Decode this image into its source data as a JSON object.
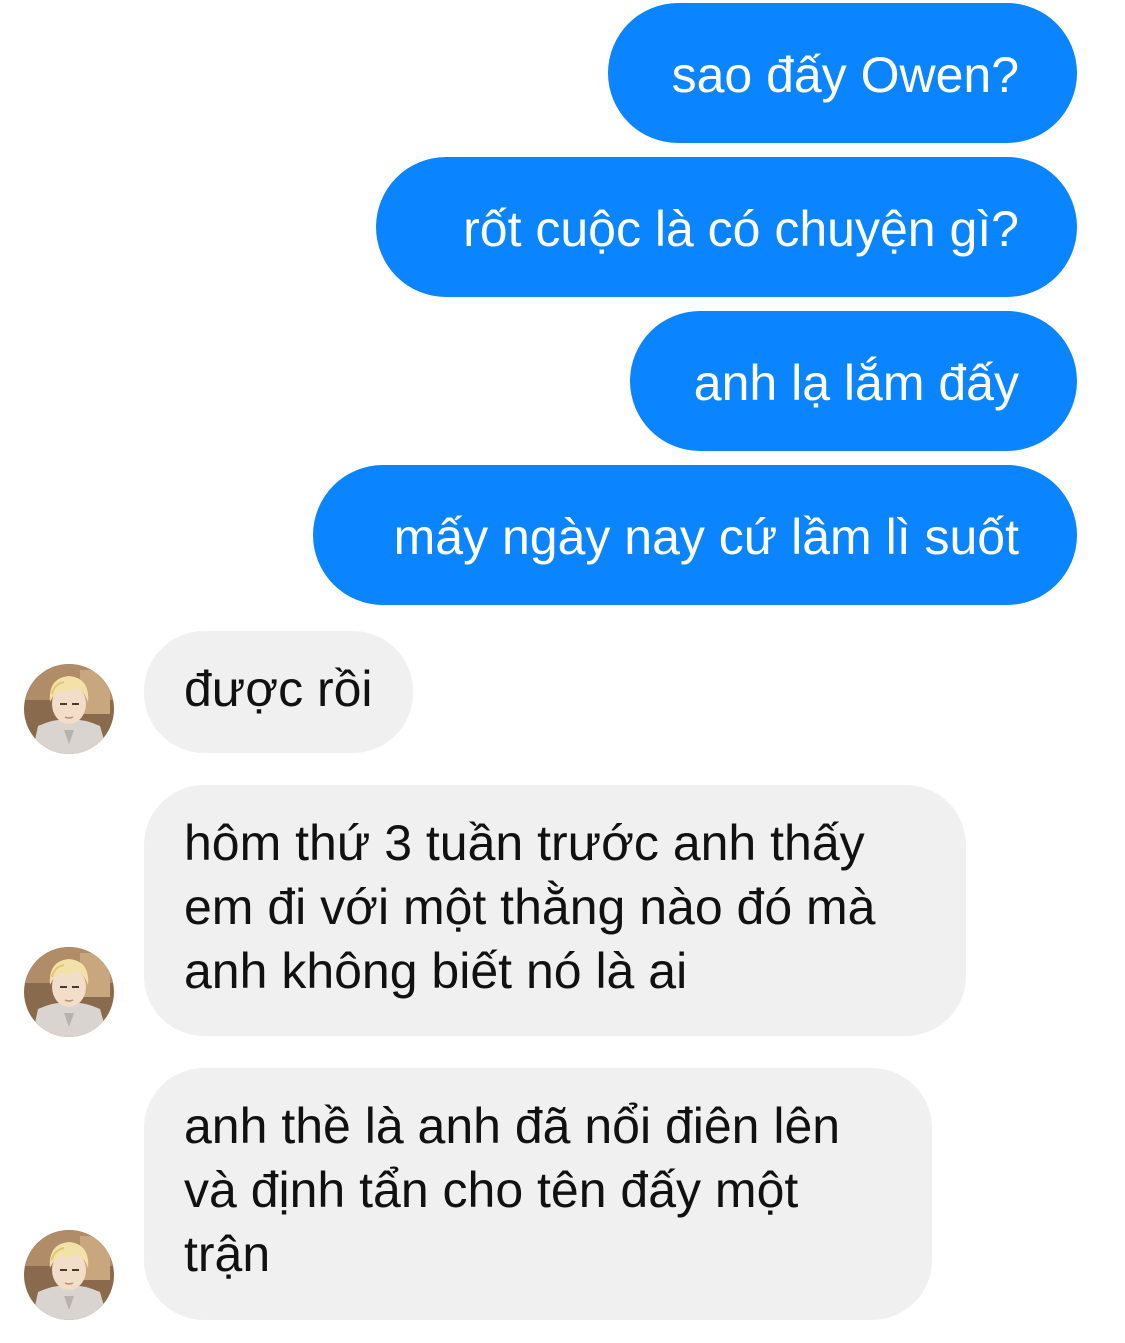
{
  "contact": {
    "avatar_icon": "contact-avatar-anime-blond-boy"
  },
  "colors": {
    "sent_bubble": "#0a84ff",
    "received_bubble": "#f0f0f0"
  },
  "messages": {
    "sent": [
      "sao đấy Owen?",
      "rốt cuộc là có chuyện gì?",
      "anh lạ lắm đấy",
      "mấy ngày nay cứ lầm lì suốt"
    ],
    "received": [
      [
        "được rồi"
      ],
      [
        "hôm thứ 3 tuần trước anh thấy",
        "em đi với một thằng nào đó mà",
        "anh không biết nó là ai"
      ],
      [
        "anh thề là anh đã nổi điên lên",
        "và định tẩn cho tên đấy một",
        "trận"
      ]
    ]
  }
}
